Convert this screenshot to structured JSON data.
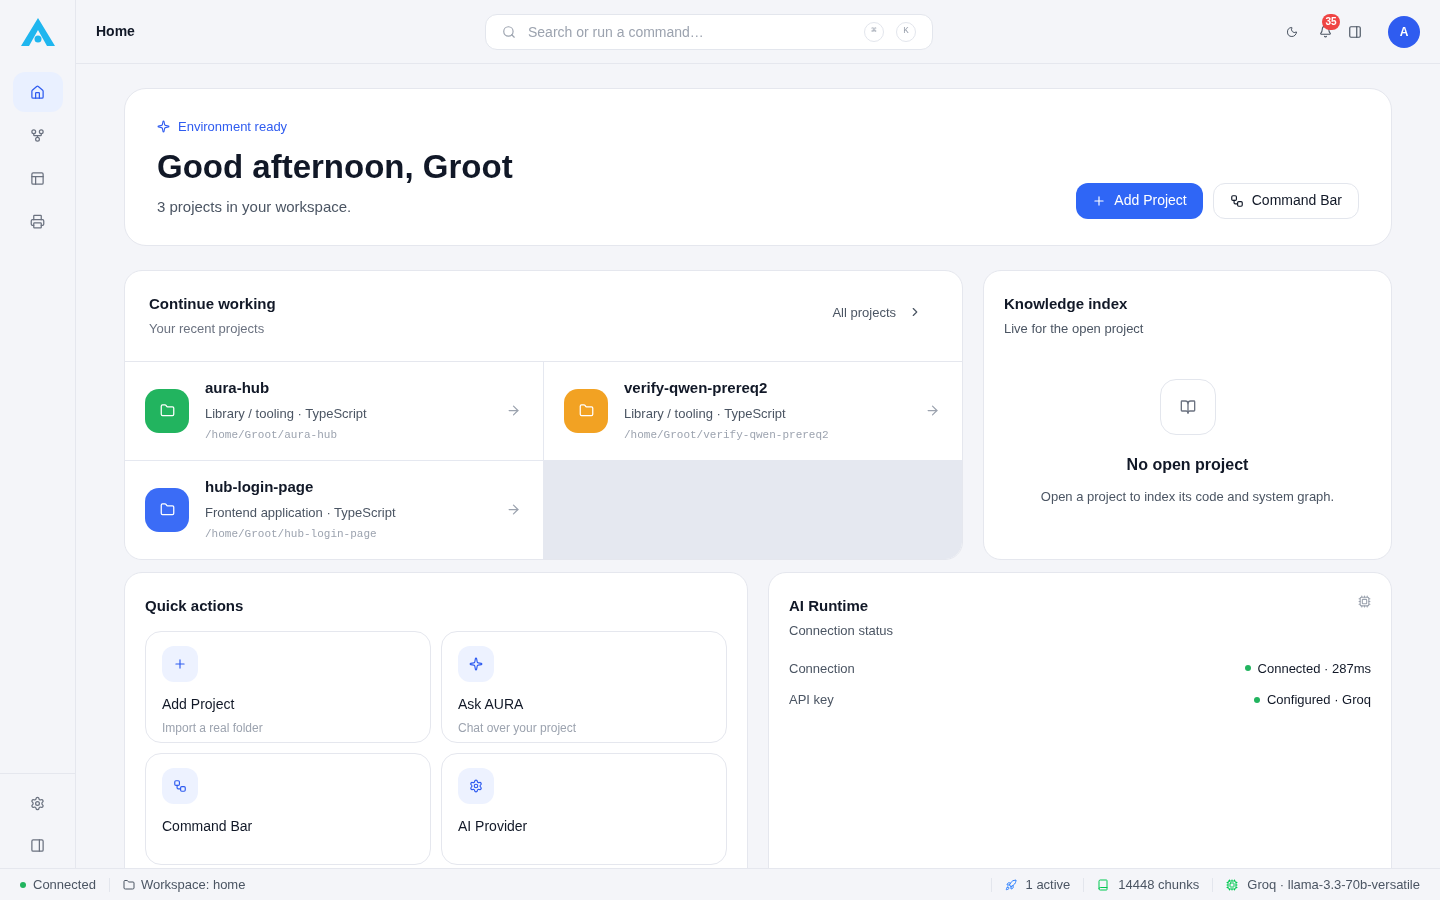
{
  "sidebar": {
    "items": [
      {
        "kind": "home",
        "selected": true
      },
      {
        "kind": "branch",
        "selected": false
      },
      {
        "kind": "layout",
        "selected": false
      },
      {
        "kind": "printer",
        "selected": false
      }
    ],
    "bottom_items": [
      {
        "kind": "settings"
      },
      {
        "kind": "panel"
      }
    ]
  },
  "header": {
    "title": "Home",
    "search": {
      "placeholder": "Search or run a command…",
      "keys": [
        "⌘",
        "K"
      ]
    },
    "notifications": "35",
    "avatar": "A"
  },
  "hero": {
    "status": "Environment ready",
    "greeting": "Good afternoon, Groot",
    "summary": "3 projects in your workspace.",
    "buttons": [
      {
        "label": "Add Project",
        "kind": "primary"
      },
      {
        "label": "Command Bar",
        "kind": "secondary"
      }
    ]
  },
  "continue_working": {
    "title": "Continue working",
    "subtitle": "Your recent projects",
    "link": "All projects",
    "projects": [
      {
        "name": "aura-hub",
        "meta": "Library / tooling · TypeScript",
        "path": "/home/Groot/aura-hub",
        "color": "#22b45f"
      },
      {
        "name": "verify-qwen-prereq2",
        "meta": "Library / tooling · TypeScript",
        "path": "/home/Groot/verify-qwen-prereq2",
        "color": "#f2a223"
      },
      {
        "name": "hub-login-page",
        "meta": "Frontend application · TypeScript",
        "path": "/home/Groot/hub-login-page",
        "color": "#3b6cf6"
      }
    ]
  },
  "knowledge_index": {
    "title": "Knowledge index",
    "subtitle": "Live for the open project",
    "empty_title": "No open project",
    "empty_text": "Open a project to index its code and system graph."
  },
  "quick_actions": {
    "title": "Quick actions",
    "actions": [
      {
        "kind": "plus",
        "title": "Add Project",
        "subtitle": "Import a real folder"
      },
      {
        "kind": "sparkle",
        "title": "Ask AURA",
        "subtitle": "Chat over your project"
      },
      {
        "kind": "nodes",
        "title": "Command Bar"
      },
      {
        "kind": "settings",
        "title": "AI Provider"
      }
    ]
  },
  "ai_runtime": {
    "title": "AI Runtime",
    "subtitle": "Connection status",
    "rows": [
      {
        "label": "Connection",
        "value": "Connected · 287ms",
        "color": "#22b45f"
      },
      {
        "label": "API key",
        "value": "Configured · Groq",
        "color": "#22b45f"
      }
    ]
  },
  "status_bar": {
    "connection": "Connected",
    "connected": true,
    "workspace": "Workspace: home",
    "items": [
      {
        "kind": "rocket",
        "text": "1 active"
      },
      {
        "kind": "book",
        "text": "14448 chunks"
      },
      {
        "kind": "cpu",
        "text": "Groq · llama-3.3-70b-versatile"
      }
    ]
  }
}
